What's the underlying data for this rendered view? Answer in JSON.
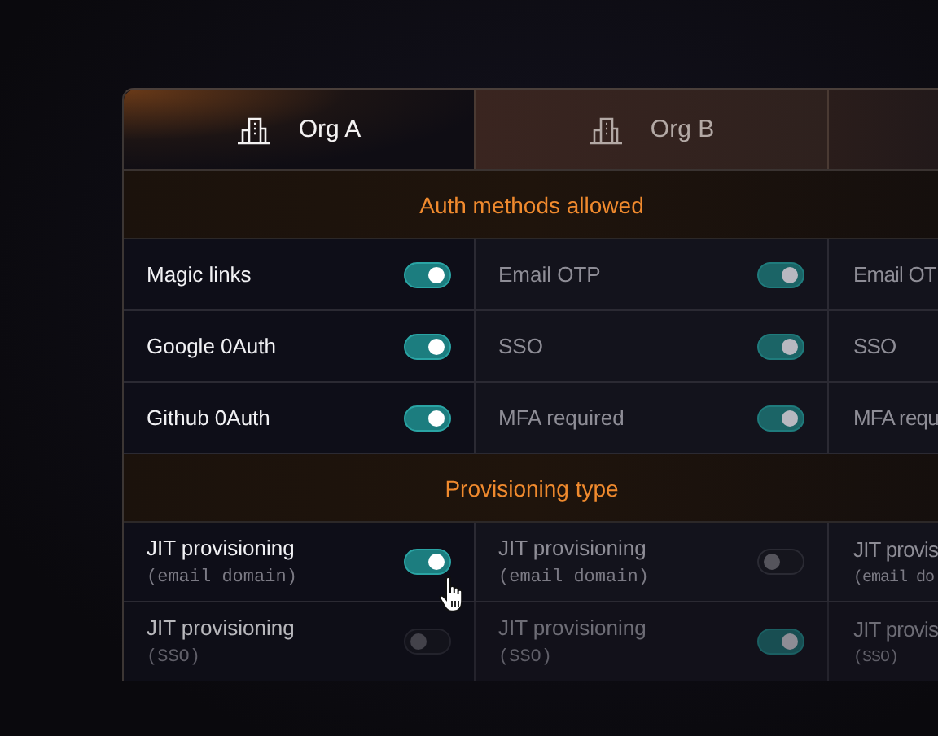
{
  "tabs": [
    {
      "label": "Org A",
      "selected": true
    },
    {
      "label": "Org B",
      "selected": false
    },
    {
      "selected": false
    }
  ],
  "sections": [
    {
      "title": "Auth methods allowed",
      "rows": [
        {
          "cells": [
            {
              "label": "Magic links",
              "on": true
            },
            {
              "label": "Email OTP",
              "on": true
            },
            {
              "label": "Email OT"
            }
          ]
        },
        {
          "cells": [
            {
              "label": "Google 0Auth",
              "on": true
            },
            {
              "label": "SSO",
              "on": true
            },
            {
              "label": "SSO"
            }
          ]
        },
        {
          "cells": [
            {
              "label": "Github 0Auth",
              "on": true
            },
            {
              "label": "MFA required",
              "on": true
            },
            {
              "label": "MFA requ"
            }
          ]
        }
      ]
    },
    {
      "title": "Provisioning type",
      "rows": [
        {
          "cells": [
            {
              "label": "JIT provisioning",
              "sublabel": "(email domain)",
              "on": true
            },
            {
              "label": "JIT provisioning",
              "sublabel": "(email domain)",
              "on": false
            },
            {
              "label": "JIT provis",
              "sublabel": "(email do"
            }
          ]
        },
        {
          "cells": [
            {
              "label": "JIT provisioning",
              "sublabel": "(SSO)",
              "on": false
            },
            {
              "label": "JIT provisioning",
              "sublabel": "(SSO)",
              "on": true
            },
            {
              "label": "JIT provis",
              "sublabel": "(SSO)"
            }
          ]
        }
      ]
    }
  ]
}
